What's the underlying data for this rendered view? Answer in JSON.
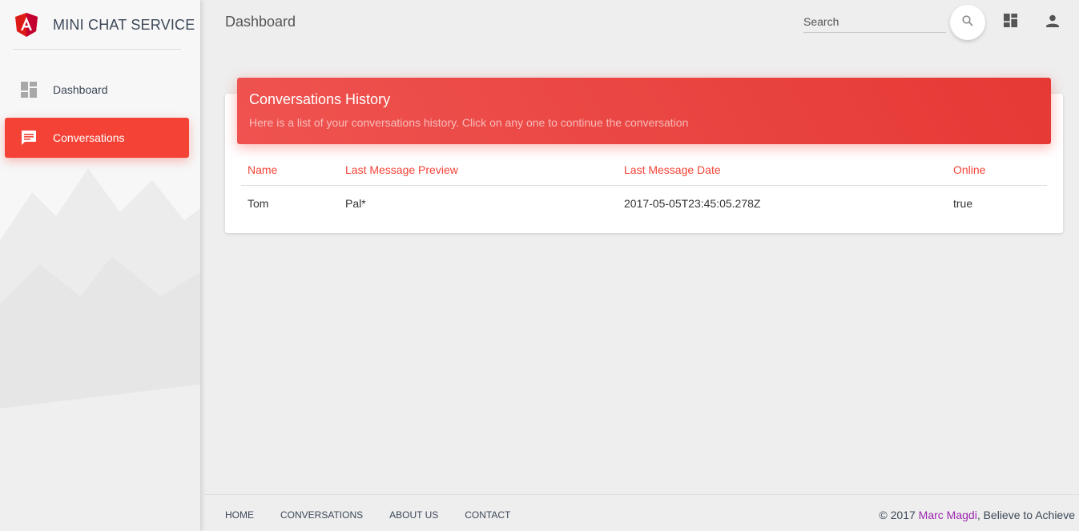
{
  "brand": {
    "name": "MINI CHAT SERVICE",
    "logo_icon": "angular-logo-icon",
    "logo_color": "#dd1b16"
  },
  "sidebar": {
    "items": [
      {
        "label": "Dashboard",
        "icon": "dashboard-icon",
        "active": false
      },
      {
        "label": "Conversations",
        "icon": "chat-icon",
        "active": true
      }
    ]
  },
  "header": {
    "title": "Dashboard",
    "search_placeholder": "Search",
    "search_icon": "search-icon",
    "icons": [
      "dashboard-icon",
      "person-icon"
    ]
  },
  "card": {
    "title": "Conversations History",
    "subtitle": "Here is a list of your conversations history. Click on any one to continue the conversation",
    "columns": [
      "Name",
      "Last Message Preview",
      "Last Message Date",
      "Online"
    ],
    "rows": [
      [
        "Tom",
        "Pal*",
        "2017-05-05T23:45:05.278Z",
        "true"
      ]
    ]
  },
  "footer": {
    "links": [
      "HOME",
      "CONVERSATIONS",
      "ABOUT US",
      "CONTACT"
    ],
    "copyright_prefix": "© 2017 ",
    "author": "Marc Magdi",
    "copyright_suffix": ", Believe to Achieve"
  },
  "colors": {
    "accent": "#f44336",
    "author_link": "#9c27b0"
  }
}
